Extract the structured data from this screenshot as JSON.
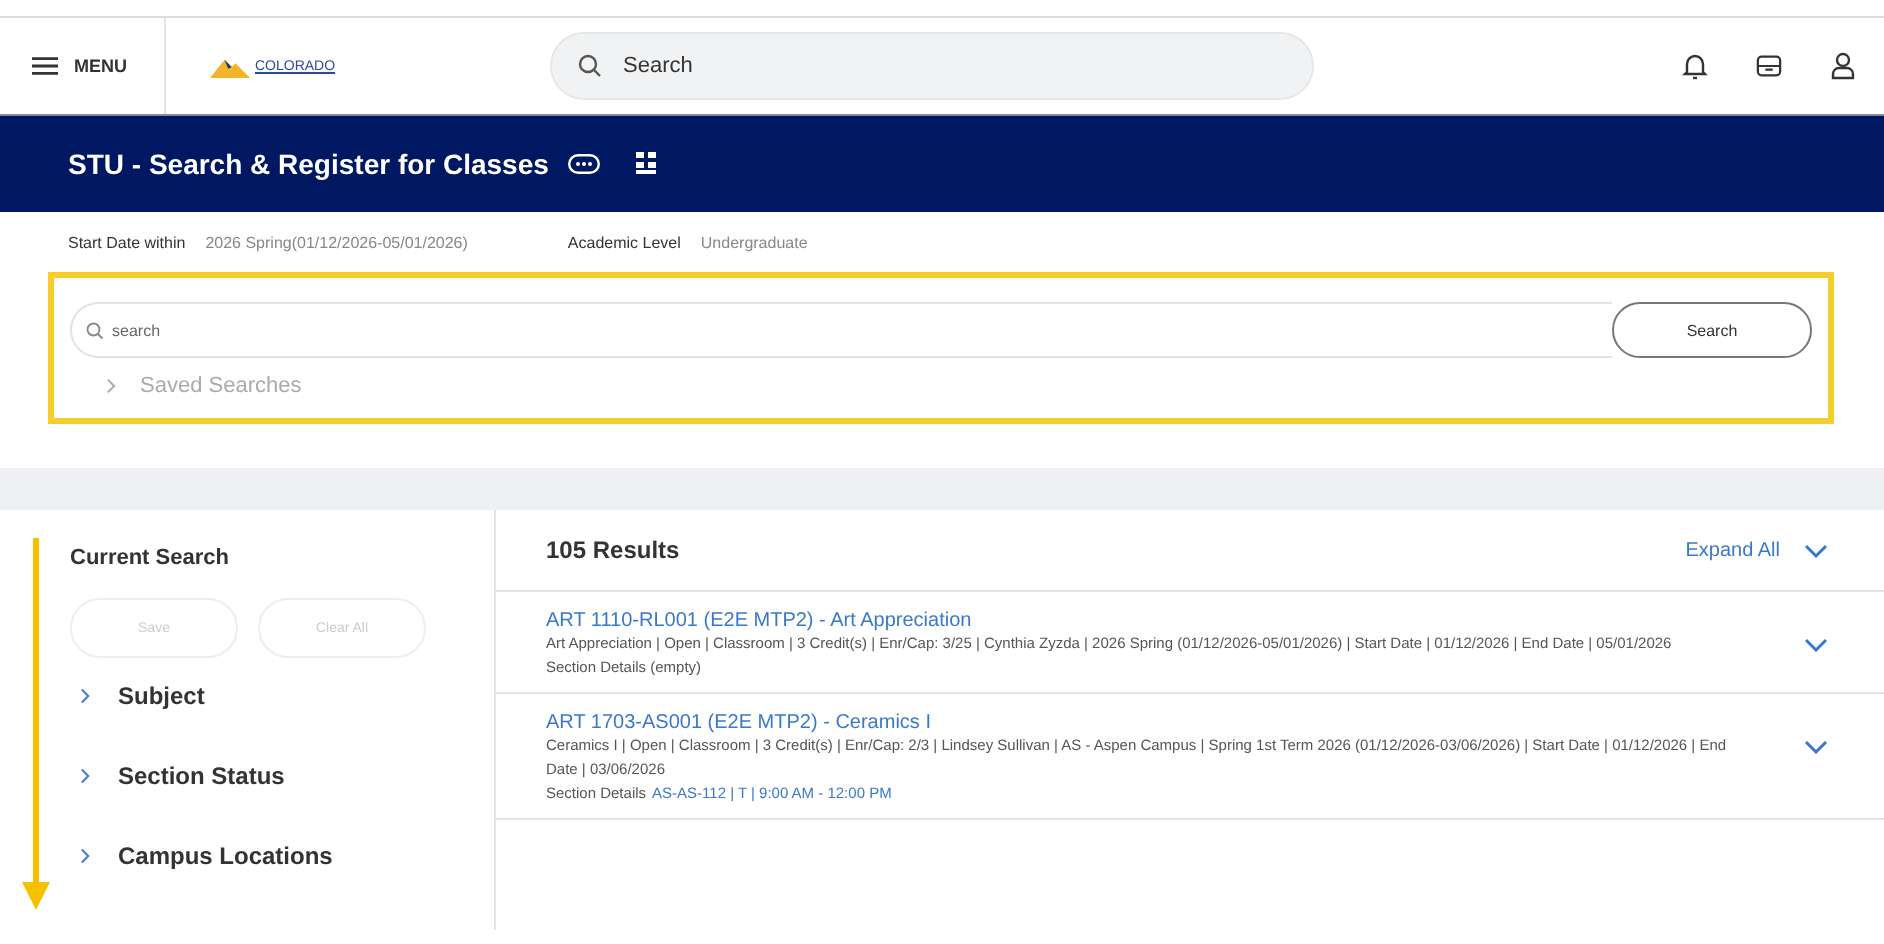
{
  "topbar": {
    "menu_label": "MENU",
    "logo_text": "COLORADO",
    "search": {
      "placeholder": "Search"
    }
  },
  "banner": {
    "title": "STU - Search & Register for Classes"
  },
  "filters": [
    {
      "label": "Start Date within",
      "value": "2026 Spring(01/12/2026-05/01/2026)"
    },
    {
      "label": "Academic Level",
      "value": "Undergraduate"
    }
  ],
  "search_panel": {
    "placeholder": "search",
    "button": "Search",
    "saved_searches": "Saved Searches",
    "highlighted": true
  },
  "sidebar": {
    "title": "Current Search",
    "buttons": [
      {
        "label": "Save",
        "disabled": true
      },
      {
        "label": "Clear All",
        "disabled": true
      }
    ],
    "facets": [
      {
        "label": "Subject",
        "expanded": false
      },
      {
        "label": "Section Status",
        "expanded": false
      },
      {
        "label": "Campus Locations",
        "expanded": false
      }
    ]
  },
  "results": {
    "count": "105 Results",
    "expand_all": "Expand All",
    "rows": [
      {
        "title": "ART 1110-RL001 (E2E MTP2) - Art Appreciation",
        "details": "Art Appreciation  |  Open  |  Classroom  |  3 Credit(s)  |  Enr/Cap: 3/25  |  Cynthia Zyzda  |  2026 Spring (01/12/2026-05/01/2026)  |  Start Date  |  01/12/2026  |  End Date  |  05/01/2026",
        "section_label": "Section Details (empty)"
      },
      {
        "title": "ART 1703-AS001 (E2E MTP2) - Ceramics I",
        "details": "Ceramics I  |  Open  |  Classroom  |  3 Credit(s)  |  Enr/Cap: 2/3  |  Lindsey Sullivan  |  AS - Aspen Campus  |  Spring 1st Term 2026 (01/12/2026-03/06/2026)  |  Start Date  |  01/12/2026  |  End Date  |  03/06/2026",
        "section_label": "Section Details",
        "section_link": "AS-AS-112 | T | 9:00 AM - 12:00 PM"
      }
    ]
  }
}
